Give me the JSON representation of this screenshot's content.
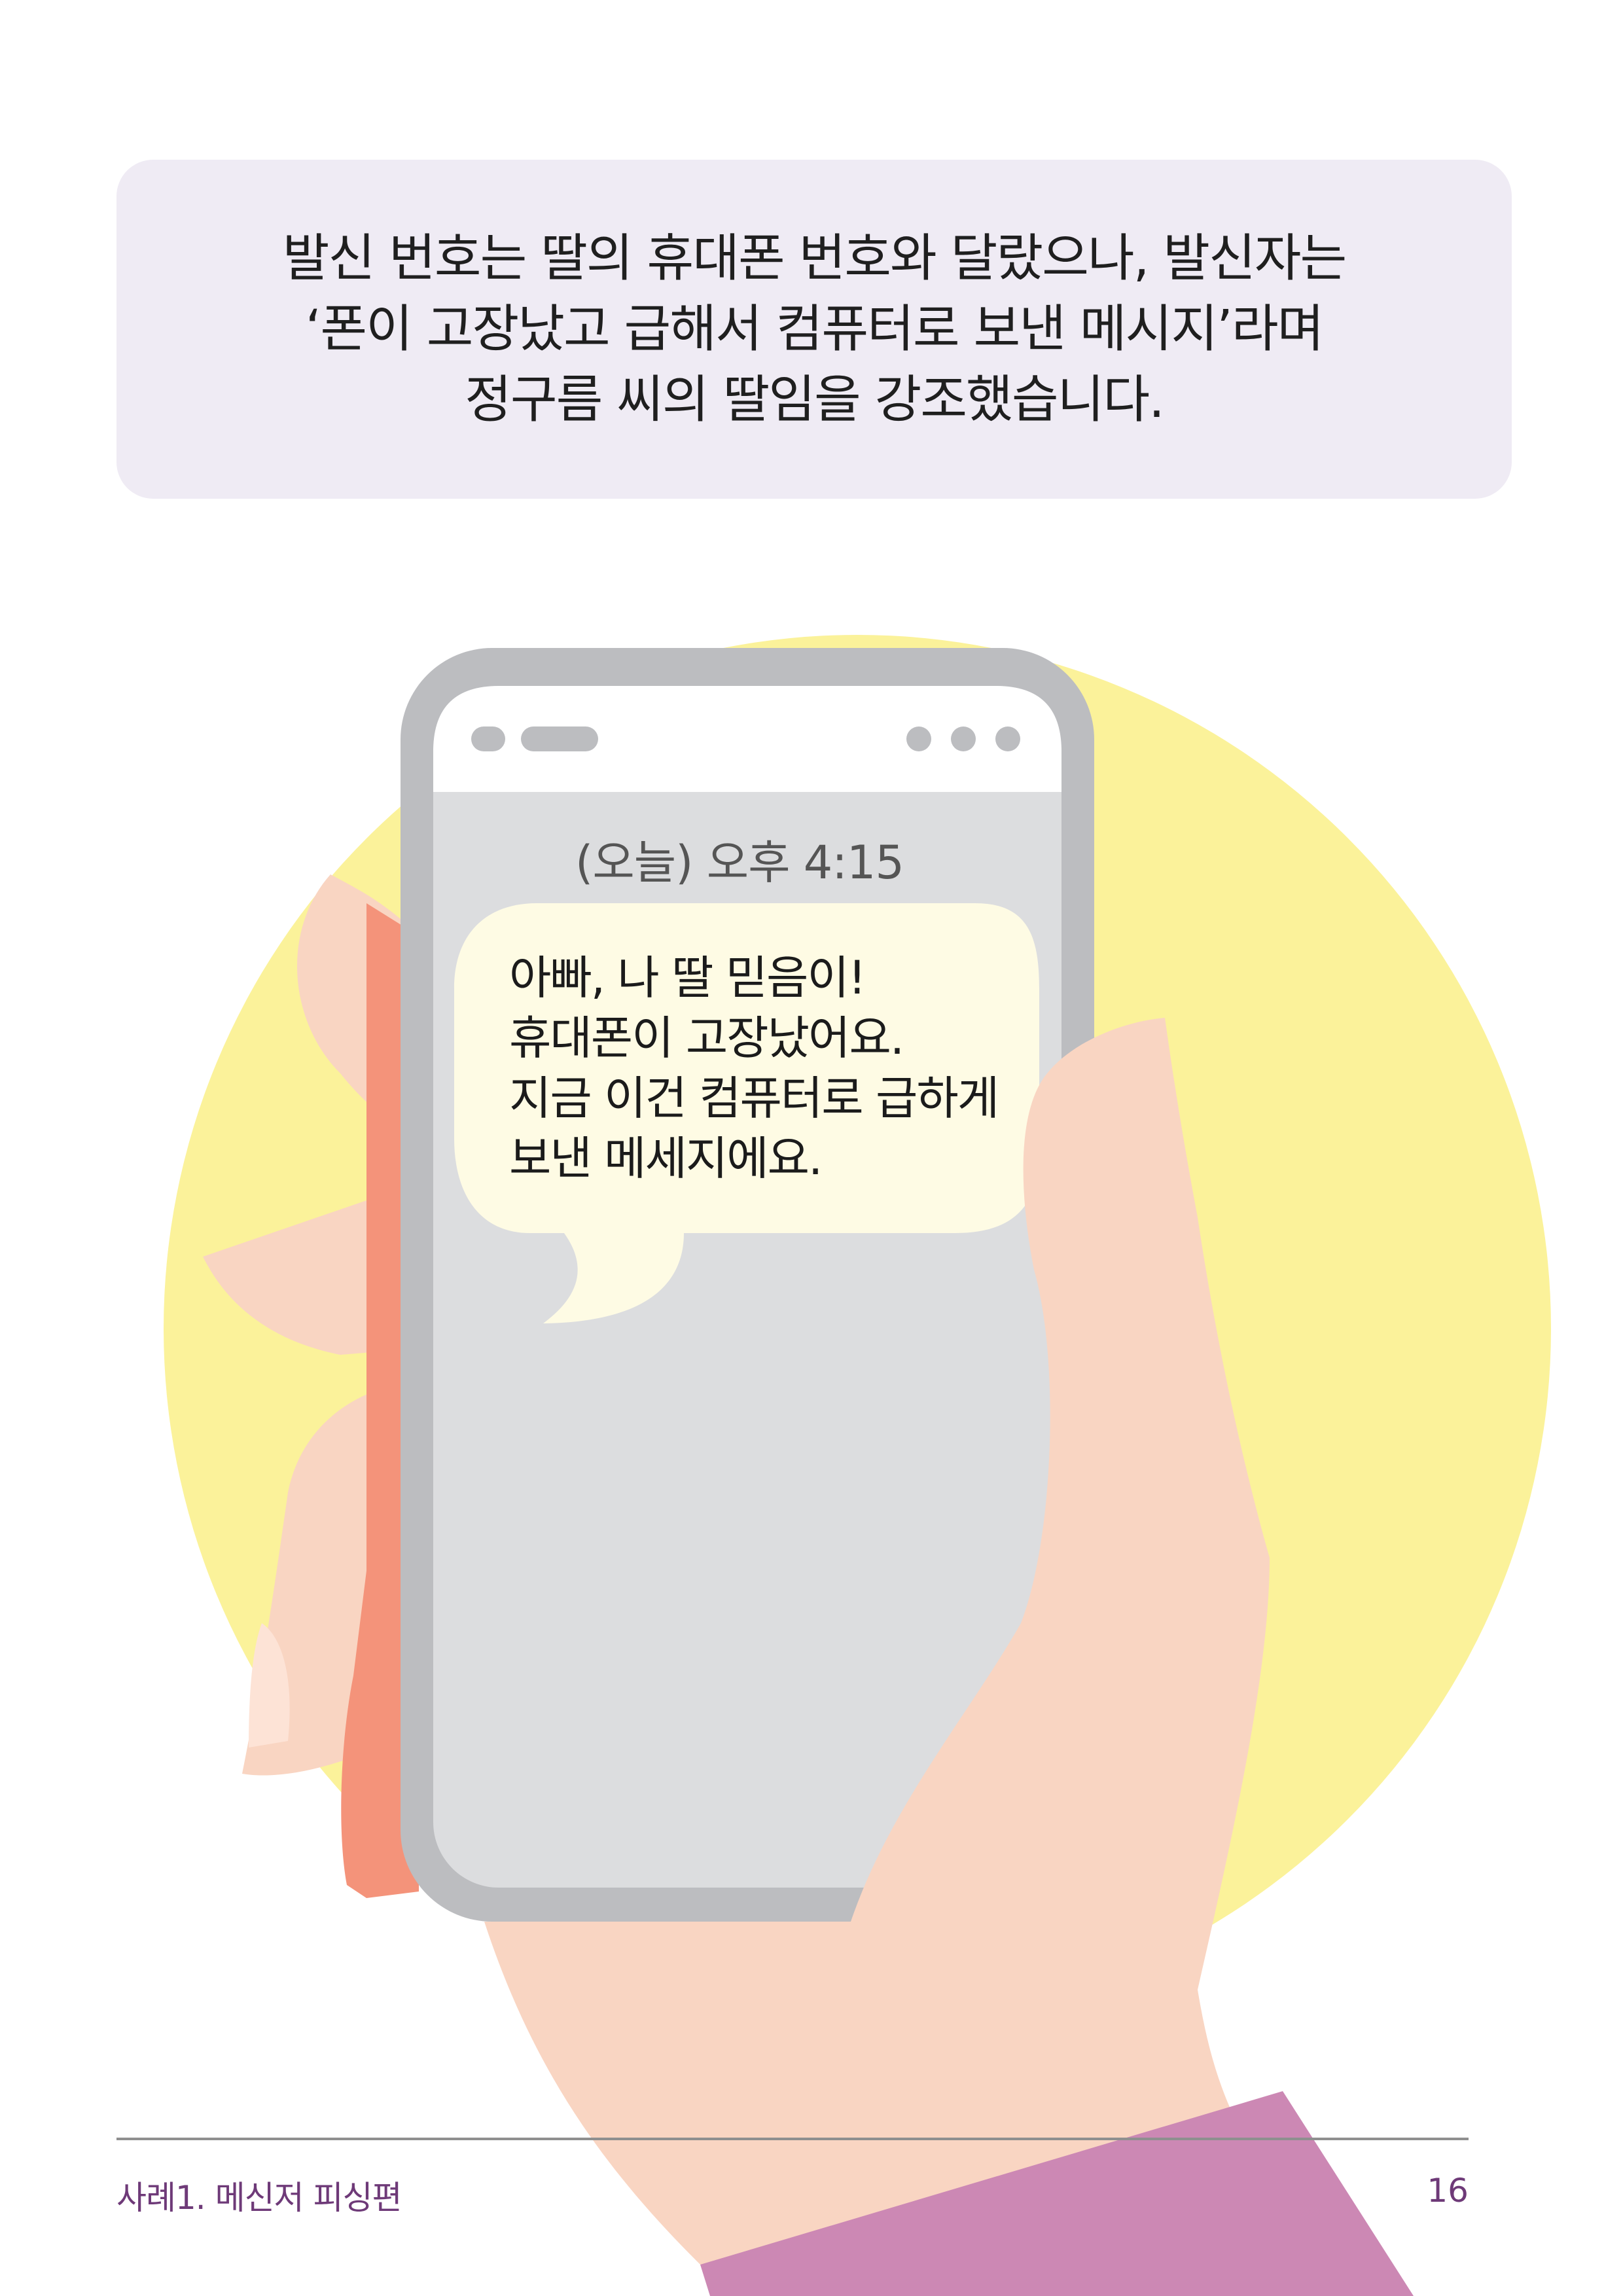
{
  "narration": {
    "lines": [
      "발신 번호는 딸의 휴대폰 번호와 달랐으나, 발신자는",
      "‘폰이 고장났고 급해서 컴퓨터로 보낸 메시지’라며",
      "정구름 씨의 딸임을 강조했습니다."
    ]
  },
  "phone": {
    "timestamp": "(오늘) 오후 4:15",
    "message_lines": [
      "아빠, 나 딸 믿음이!",
      "휴대폰이 고장났어요.",
      "지금 이건 컴퓨터로 급하게",
      "보낸 메세지에요."
    ]
  },
  "footer": {
    "section_label": "사례1. 메신저 피싱편",
    "page_number": "16"
  },
  "colors": {
    "narration_bg": "#efebf4",
    "sun": "#fbf29a",
    "skin": "#f9d5c2",
    "skin_shadow": "#f4937a",
    "phone_frame": "#bcbdc0",
    "screen": "#dcdddf",
    "bubble": "#fefbe4",
    "sleeve": "#cc88b4",
    "footer_text": "#6e3a78"
  }
}
